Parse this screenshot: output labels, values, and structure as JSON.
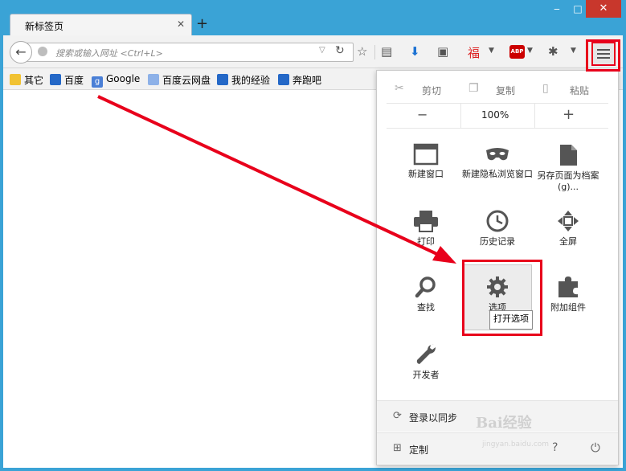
{
  "window": {
    "tab_title": "新标签页",
    "tab_close": "✕",
    "new_tab": "+",
    "controls": {
      "minimize": "‒",
      "maximize": "□",
      "close": "✕"
    }
  },
  "navbar": {
    "back": "←",
    "url_placeholder": "搜索或输入网址 <Ctrl+L>",
    "url_dropdown": "▽",
    "reload": "↻",
    "toolbar_icons": [
      "star-icon",
      "reading-list-icon",
      "download-icon",
      "screenshot-icon",
      "fu-icon",
      "adblock-plus-icon",
      "bug-icon",
      "menu-icon"
    ],
    "abp_label": "ABP",
    "fu_glyph": "福"
  },
  "bookmarks": [
    "其它",
    "百度",
    "Google",
    "百度云网盘",
    "我的经验",
    "奔跑吧"
  ],
  "menu": {
    "cut": "剪切",
    "copy": "复制",
    "paste": "粘贴",
    "zoom_out": "−",
    "zoom": "100%",
    "zoom_in": "+",
    "items": [
      {
        "label": "新建窗口",
        "icon": "new-window-icon"
      },
      {
        "label": "新建隐私浏览窗口",
        "icon": "private-mask-icon"
      },
      {
        "label": "另存页面为档案 (g)...",
        "icon": "save-page-icon"
      },
      {
        "label": "打印",
        "icon": "print-icon"
      },
      {
        "label": "历史记录",
        "icon": "history-icon"
      },
      {
        "label": "全屏",
        "icon": "fullscreen-icon"
      },
      {
        "label": "查找",
        "icon": "search-icon"
      },
      {
        "label": "选项",
        "icon": "gear-icon"
      },
      {
        "label": "附加组件",
        "icon": "puzzle-icon"
      },
      {
        "label": "开发者",
        "icon": "wrench-icon"
      }
    ],
    "tooltip": "打开选项",
    "sync": "登录以同步",
    "customize": "定制"
  },
  "colors": {
    "titlebar": "#3aa3d6",
    "close_button": "#c8372c",
    "highlight": "#e8001b",
    "icon": "#555555"
  },
  "watermark": {
    "brand": "Bai经验",
    "url": "jingyan.baidu.com"
  }
}
